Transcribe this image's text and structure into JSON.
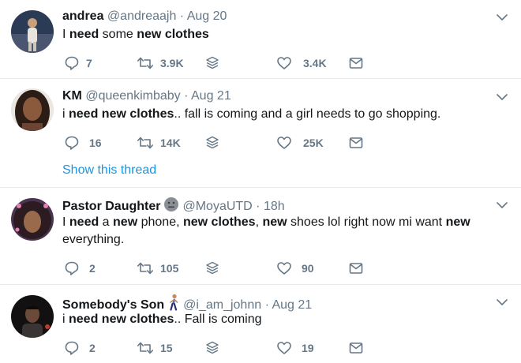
{
  "tweets": [
    {
      "name": "andrea",
      "handle": "@andreaajh",
      "sep": "·",
      "time": "Aug 20",
      "text_parts": [
        "I ",
        "need",
        " some ",
        "new clothes",
        ""
      ],
      "replies": "7",
      "retweets": "3.9K",
      "likes": "3.4K",
      "avatar_color": "#2b3a55"
    },
    {
      "name": "KM",
      "handle": "@queenkimbaby",
      "sep": "·",
      "time": "Aug 21",
      "text_parts": [
        "i ",
        "need new clothes",
        ".. fall is coming and a girl needs to go shopping.",
        "",
        ""
      ],
      "replies": "16",
      "retweets": "14K",
      "likes": "25K",
      "show_thread": "Show this thread",
      "avatar_color": "#5a3a2c"
    },
    {
      "name": "Pastor Daughter",
      "name_emoji": "neutral-face-emoji",
      "handle": "@MoyaUTD",
      "sep": "·",
      "time": "18h",
      "text_line1": [
        "I ",
        "need",
        " a ",
        "new",
        " phone, ",
        "new clothes",
        ", ",
        "new",
        " shoes lol right now mi want ",
        "new"
      ],
      "text_line2": "everything.",
      "replies": "2",
      "retweets": "105",
      "likes": "90",
      "avatar_color": "#3b2a3f"
    },
    {
      "name": "Somebody's Son",
      "name_emoji": "person-walking-emoji",
      "handle": "@i_am_johnn",
      "sep": "·",
      "time": "Aug 21",
      "text_parts": [
        "i ",
        "need new clothes",
        ".. Fall is coming",
        "",
        ""
      ],
      "replies": "2",
      "retweets": "15",
      "likes": "19",
      "avatar_color": "#1e1a1a"
    }
  ],
  "colors": {
    "text": "#14171a",
    "muted": "#657786",
    "link": "#1b95e0",
    "divider": "#e6ecf0"
  },
  "icons": [
    "reply-icon",
    "retweet-icon",
    "stack-icon",
    "like-icon",
    "message-icon",
    "chevron-down-icon"
  ]
}
